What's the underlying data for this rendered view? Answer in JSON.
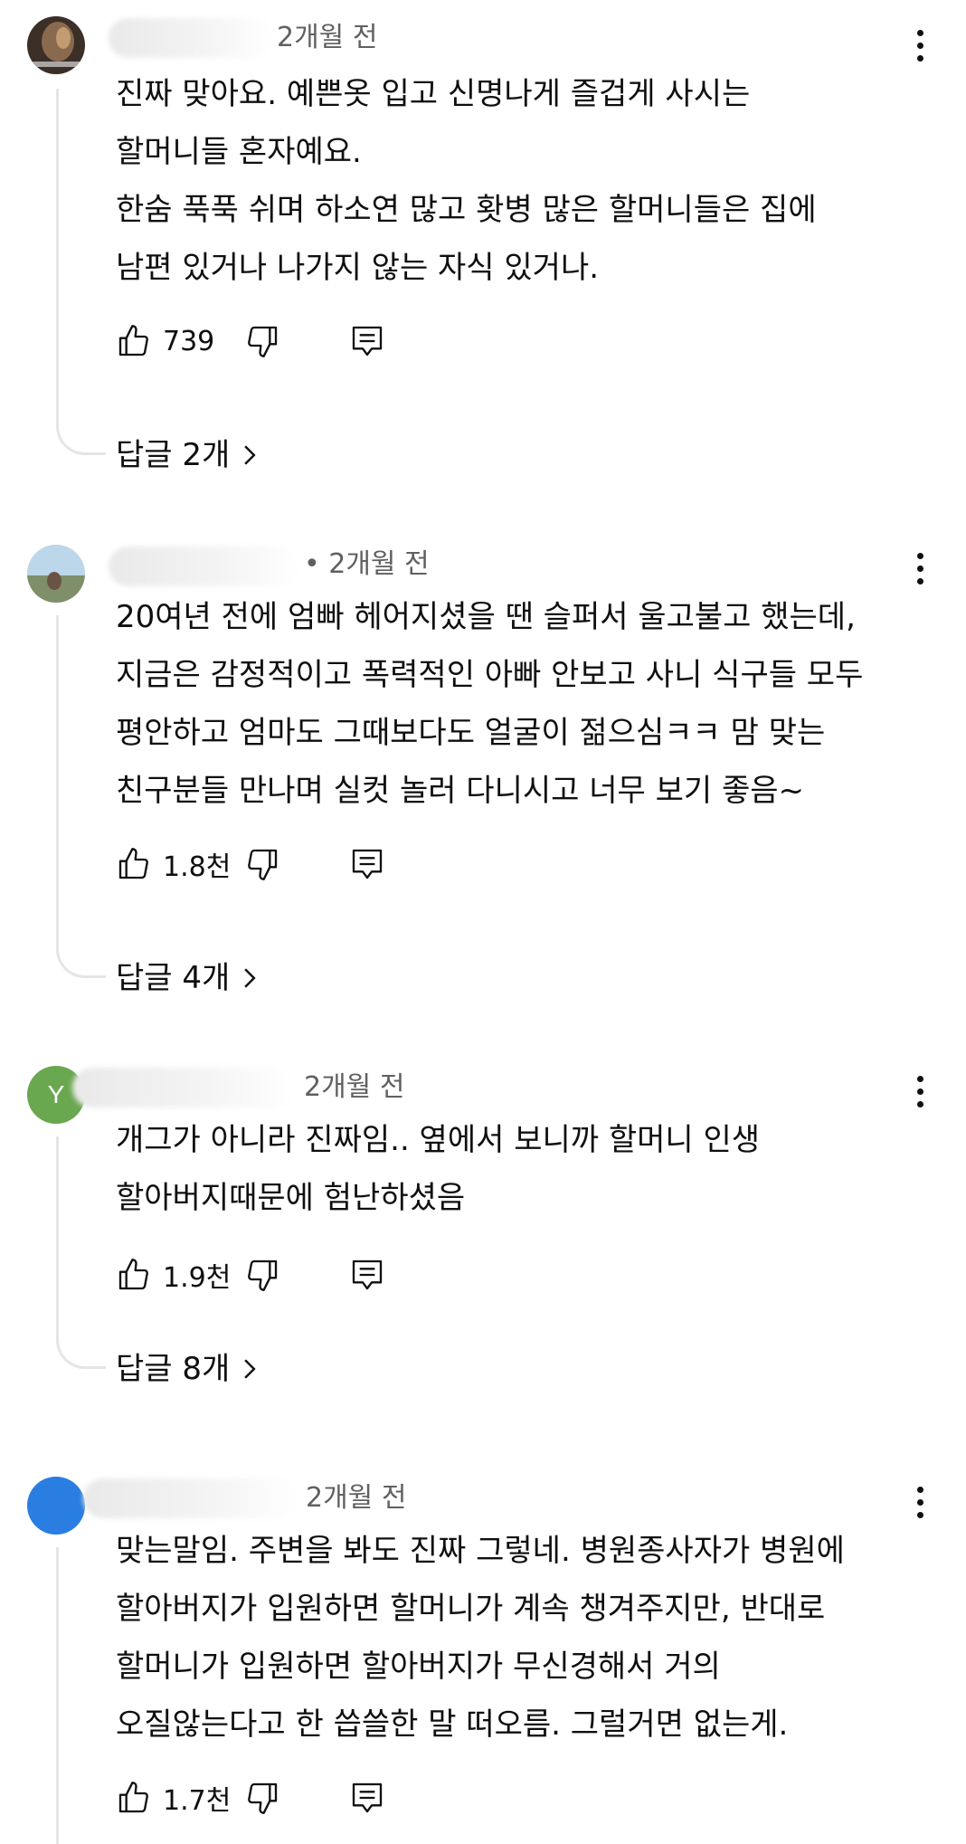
{
  "comments": [
    {
      "time": "2개월 전",
      "lines": [
        "진짜 맞아요. 예쁜옷 입고 신명나게 즐겁게 사시는",
        "할머니들 혼자예요.",
        "한숨 푹푹 쉬며 하소연 많고 홧병 많은 할머니들은 집에",
        "남편 있거나 나가지 않는 자식 있거나."
      ],
      "likes": "739",
      "replies": "답글 2개"
    },
    {
      "time": "• 2개월 전",
      "lines": [
        "20여년 전에 엄빠 헤어지셨을 땐 슬퍼서 울고불고 했는데,",
        "지금은 감정적이고 폭력적인 아빠 안보고 사니 식구들 모두",
        "평안하고 엄마도 그때보다도 얼굴이 젊으심ㅋㅋ 맘 맞는",
        "친구분들 만나며 실컷 놀러 다니시고 너무 보기 좋음~"
      ],
      "likes": "1.8천",
      "replies": "답글 4개"
    },
    {
      "time": "2개월 전",
      "avatar_letter": "Y",
      "lines": [
        "개그가 아니라 진짜임.. 옆에서 보니까 할머니 인생",
        "할아버지때문에 험난하셨음"
      ],
      "likes": "1.9천",
      "replies": "답글 8개"
    },
    {
      "time": "2개월 전",
      "lines": [
        "맞는말임. 주변을 봐도 진짜 그렇네. 병원종사자가 병원에",
        "할아버지가 입원하면 할머니가 계속 챙겨주지만, 반대로",
        "할머니가 입원하면 할아버지가 무신경해서 거의",
        "오질않는다고 한 씁쓸한 말 떠오름. 그럴거면 없는게."
      ],
      "likes": "1.7천"
    }
  ],
  "icons": {
    "like": "thumbs-up-icon",
    "dislike": "thumbs-down-icon",
    "reply": "comment-icon",
    "more": "more-vertical-icon",
    "replies": "chevron-right-icon"
  },
  "colors": {
    "text": "#0f0f0f",
    "secondary": "#606060",
    "thread_line": "#e5e5e5",
    "avatar_green": "#6aa84f",
    "avatar_blue": "#2a7de1"
  }
}
